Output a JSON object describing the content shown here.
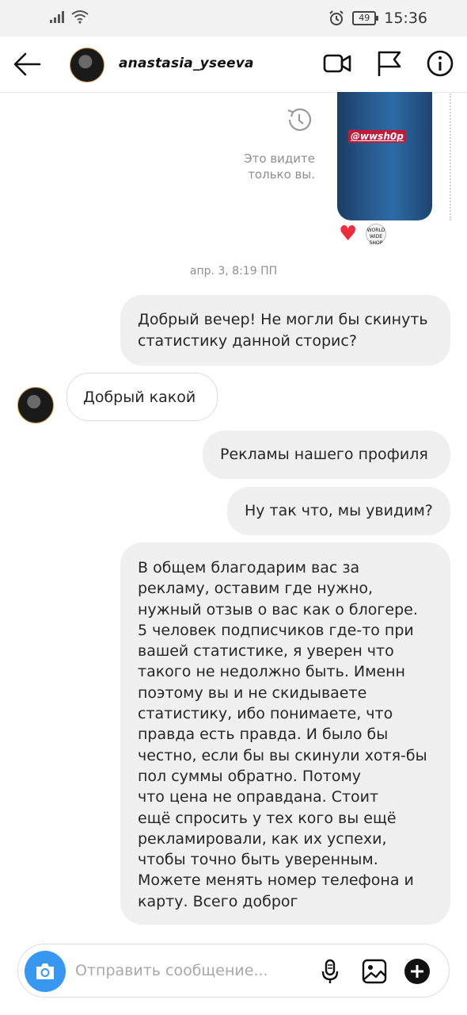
{
  "status_bar": {
    "battery": "49",
    "time": "15:36"
  },
  "header": {
    "username": "anastasia_yseeva",
    "icons": [
      "back-arrow-icon",
      "video-call-icon",
      "flag-icon",
      "info-icon"
    ]
  },
  "story_reply": {
    "tag": "@wwsh0p",
    "only_you_line1": "Это видите",
    "only_you_line2": "только вы.",
    "sticker": "WORLD WIDE SHOP"
  },
  "timestamp": "апр. 3, 8:19 ПП",
  "messages": [
    {
      "from": "me",
      "text": "Добрый вечер! Не могли бы скинуть статистику данной сторис?"
    },
    {
      "from": "them",
      "text": "Добрый какой"
    },
    {
      "from": "me",
      "text": "Рекламы нашего профиля"
    },
    {
      "from": "me",
      "text": "Ну так что, мы увидим?"
    },
    {
      "from": "me",
      "text": "В общем благодарим вас за\nрекламу, оставим где нужно,\nнужный отзыв о вас как о блогере.\n5 человек подписчиков где-то при\nвашей статистике, я уверен что\nтакого не недолжно быть. Именн\nпоэтому вы и не скидываете\nстатистику, ибо понимаете, что\nправда есть правда. И было бы\nчестно, если бы вы скинули хотя-бы\nпол суммы обратно. Потому\nчто цена не оправдана. Стоит\nещё спросить у тех кого вы ещё\nрекламировали, как их успехи,\nчтобы точно быть уверенным.\nМожете менять номер телефона и\nкарту. Всего доброг"
    }
  ],
  "composer": {
    "placeholder": "Отправить сообщение..."
  },
  "colors": {
    "accent": "#3897f0",
    "heart": "#ed2d3a",
    "bubble_out": "#efefef"
  }
}
